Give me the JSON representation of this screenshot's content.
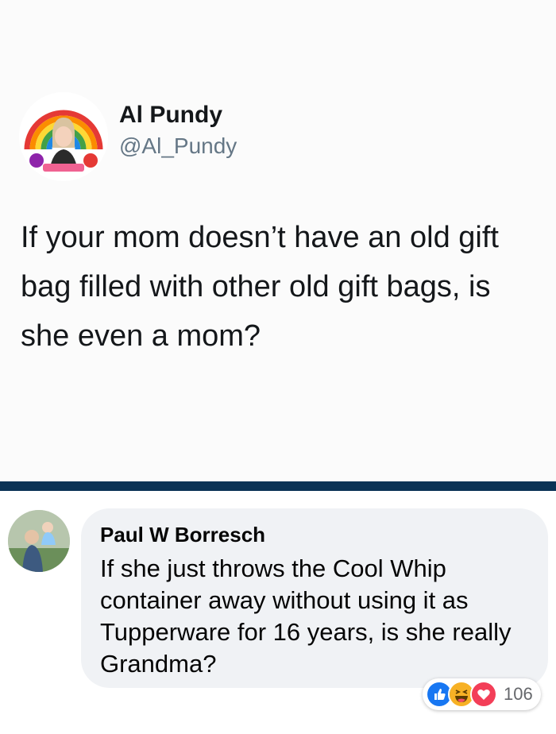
{
  "tweet": {
    "author_name": "Al Pundy",
    "author_handle": "@Al_Pundy",
    "text": "If your mom doesn’t have an old gift bag filled with other old gift bags, is she even a mom?"
  },
  "comment": {
    "author_name": "Paul W Borresch",
    "text": "If she just throws the Cool Whip container away without using it as Tupperware for 16 years, is she really Grandma?",
    "reactions": {
      "icons": [
        "like-icon",
        "haha-icon",
        "love-icon"
      ],
      "count": "106"
    }
  },
  "colors": {
    "divider": "#0b3356",
    "handle": "#657786",
    "bubble": "#f0f2f5",
    "like": "#1877f2",
    "haha": "#f7b125",
    "love": "#f33e58"
  }
}
